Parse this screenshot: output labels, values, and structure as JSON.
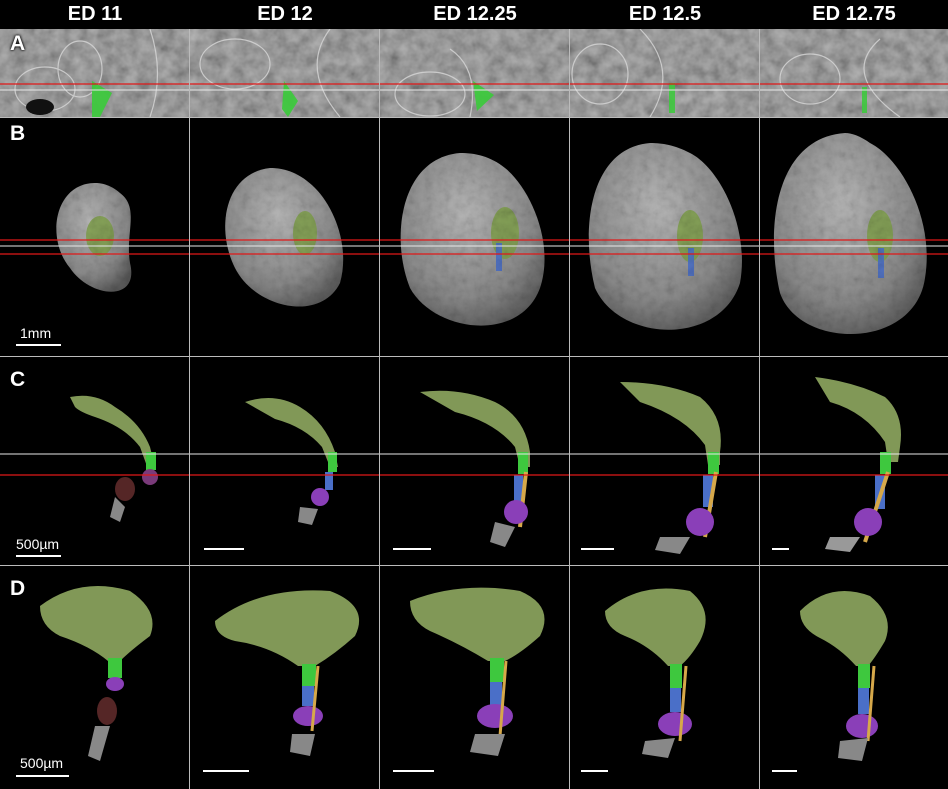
{
  "columns": [
    "ED 11",
    "ED 12",
    "ED 12.25",
    "ED 12.5",
    "ED 12.75"
  ],
  "rows": [
    "A",
    "B",
    "C",
    "D"
  ],
  "scale_labels": {
    "row_b": "1mm",
    "row_c": "500µm",
    "row_d": "500µm"
  },
  "colors": {
    "green_region": "#8fa860",
    "bright_green": "#3ec83e",
    "blue_region": "#4a6fc8",
    "orange_region": "#d6a84a",
    "purple_region": "#8a3fb8",
    "red_line": "#e01818",
    "white_line": "#e8e8e8"
  }
}
